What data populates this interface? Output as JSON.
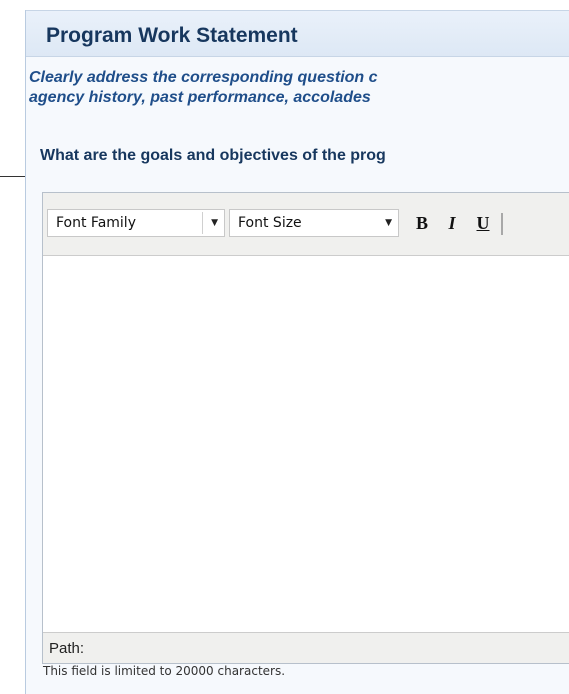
{
  "panel": {
    "title": "Program Work Statement",
    "instructions_line1": "Clearly address the corresponding question c",
    "instructions_line2": "agency history, past performance, accolades",
    "question": "What are the goals and objectives of the prog"
  },
  "editor": {
    "toolbar": {
      "font_family_label": "Font Family",
      "font_size_label": "Font Size",
      "bold_label": "B",
      "italic_label": "I",
      "underline_label": "U",
      "dropdown_icon": "chevron-down-icon"
    },
    "content": "",
    "status_path_label": "Path:"
  },
  "field_limit_note": "This field is limited to 20000 characters.",
  "colors": {
    "title": "#17375e",
    "instructions": "#1f4e8a",
    "panel_background": "#f6f9fd",
    "toolbar_background": "#f0f0ee"
  }
}
